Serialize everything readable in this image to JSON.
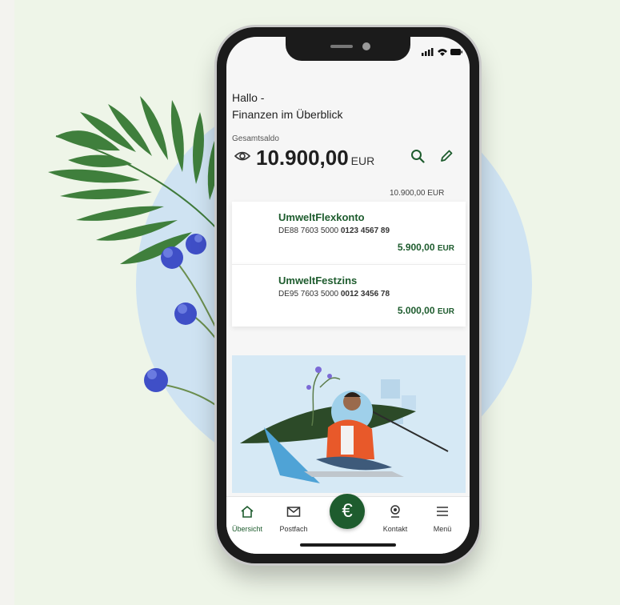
{
  "header": {
    "greeting_line1": "Hallo -",
    "greeting_line2": "Finanzen im Überblick"
  },
  "balance": {
    "label": "Gesamtsaldo",
    "amount": "10.900,00",
    "currency": "EUR",
    "sum_right": "10.900,00 EUR"
  },
  "accounts": [
    {
      "name": "UmweltFlexkonto",
      "iban_prefix": "DE88 7603 5000",
      "iban_suffix": "0123 4567 89",
      "balance": "5.900,00",
      "currency": "EUR"
    },
    {
      "name": "UmweltFestzins",
      "iban_prefix": "DE95 7603 5000",
      "iban_suffix": "0012 3456 78",
      "balance": "5.000,00",
      "currency": "EUR"
    }
  ],
  "tabbar": {
    "items": [
      {
        "label": "Übersicht",
        "icon": "home-icon"
      },
      {
        "label": "Postfach",
        "icon": "mail-icon"
      },
      {
        "label": "",
        "icon": "euro-icon"
      },
      {
        "label": "Kontakt",
        "icon": "contact-icon"
      },
      {
        "label": "Menü",
        "icon": "menu-icon"
      }
    ]
  },
  "colors": {
    "brand_green": "#1e5c2e",
    "background": "#eef5e8",
    "circle": "#cfe3f2"
  }
}
